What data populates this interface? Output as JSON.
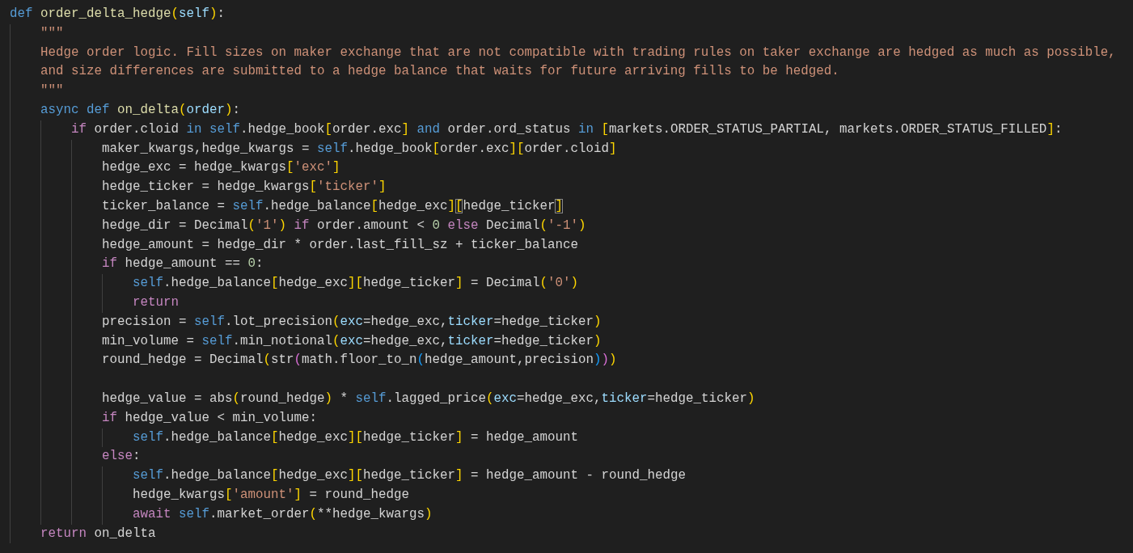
{
  "editor": {
    "lines": [
      {
        "kind": "code",
        "tokens": [
          {
            "kind": "kw",
            "text": "def"
          },
          {
            "kind": "fn",
            "text": " order_delta_hedge"
          },
          {
            "kind": "b1",
            "text": "("
          },
          {
            "kind": "var",
            "text": "self"
          },
          {
            "kind": "b1",
            "text": ")"
          },
          {
            "kind": "txt",
            "text": ":"
          }
        ],
        "children": [
          {
            "kind": "code",
            "tokens": [
              {
                "kind": "str",
                "text": "\"\"\""
              }
            ]
          },
          {
            "kind": "code",
            "tokens": [
              {
                "kind": "str",
                "text": "Hedge order logic. Fill sizes on maker exchange that are not compatible with trading rules on taker exchange are hedged as much as possible,"
              }
            ]
          },
          {
            "kind": "code",
            "tokens": [
              {
                "kind": "str",
                "text": "and size differences are submitted to a hedge balance that waits for future arriving fills to be hedged."
              }
            ]
          },
          {
            "kind": "code",
            "tokens": [
              {
                "kind": "str",
                "text": "\"\"\""
              }
            ]
          },
          {
            "kind": "code",
            "tokens": [
              {
                "kind": "kw",
                "text": "async def"
              },
              {
                "kind": "fn",
                "text": " on_delta"
              },
              {
                "kind": "b1",
                "text": "("
              },
              {
                "kind": "var",
                "text": "order"
              },
              {
                "kind": "b1",
                "text": ")"
              },
              {
                "kind": "txt",
                "text": ":"
              }
            ],
            "children": [
              {
                "kind": "code",
                "tokens": [
                  {
                    "kind": "ctl",
                    "text": "if"
                  },
                  {
                    "kind": "txt",
                    "text": " order.cloid"
                  },
                  {
                    "kind": "kw",
                    "text": " in"
                  },
                  {
                    "kind": "kw",
                    "text": " self"
                  },
                  {
                    "kind": "txt",
                    "text": ".hedge_book"
                  },
                  {
                    "kind": "b1",
                    "text": "["
                  },
                  {
                    "kind": "txt",
                    "text": "order.exc"
                  },
                  {
                    "kind": "b1",
                    "text": "]"
                  },
                  {
                    "kind": "kw",
                    "text": " and"
                  },
                  {
                    "kind": "txt",
                    "text": " order.ord_status"
                  },
                  {
                    "kind": "kw",
                    "text": " in"
                  },
                  {
                    "kind": "b1",
                    "text": " ["
                  },
                  {
                    "kind": "txt",
                    "text": "markets.ORDER_STATUS_PARTIAL, markets.ORDER_STATUS_FILLED"
                  },
                  {
                    "kind": "b1",
                    "text": "]"
                  },
                  {
                    "kind": "txt",
                    "text": ":"
                  }
                ],
                "children": [
                  {
                    "kind": "code",
                    "tokens": [
                      {
                        "kind": "txt",
                        "text": "maker_kwargs,hedge_kwargs ="
                      },
                      {
                        "kind": "kw",
                        "text": " self"
                      },
                      {
                        "kind": "txt",
                        "text": ".hedge_book"
                      },
                      {
                        "kind": "b1",
                        "text": "["
                      },
                      {
                        "kind": "txt",
                        "text": "order.exc"
                      },
                      {
                        "kind": "b1",
                        "text": "]"
                      },
                      {
                        "kind": "b1",
                        "text": "["
                      },
                      {
                        "kind": "txt",
                        "text": "order.cloid"
                      },
                      {
                        "kind": "b1",
                        "text": "]"
                      }
                    ]
                  },
                  {
                    "kind": "code",
                    "tokens": [
                      {
                        "kind": "txt",
                        "text": "hedge_exc = hedge_kwargs"
                      },
                      {
                        "kind": "b1",
                        "text": "["
                      },
                      {
                        "kind": "str",
                        "text": "'exc'"
                      },
                      {
                        "kind": "b1",
                        "text": "]"
                      }
                    ]
                  },
                  {
                    "kind": "code",
                    "tokens": [
                      {
                        "kind": "txt",
                        "text": "hedge_ticker = hedge_kwargs"
                      },
                      {
                        "kind": "b1",
                        "text": "["
                      },
                      {
                        "kind": "str",
                        "text": "'ticker'"
                      },
                      {
                        "kind": "b1",
                        "text": "]"
                      }
                    ]
                  },
                  {
                    "kind": "code",
                    "tokens": [
                      {
                        "kind": "txt",
                        "text": "ticker_balance ="
                      },
                      {
                        "kind": "kw",
                        "text": " self"
                      },
                      {
                        "kind": "txt",
                        "text": ".hedge_balance"
                      },
                      {
                        "kind": "b1",
                        "text": "["
                      },
                      {
                        "kind": "txt",
                        "text": "hedge_exc"
                      },
                      {
                        "kind": "b1",
                        "text": "]"
                      },
                      {
                        "kind": "bm",
                        "text": "["
                      },
                      {
                        "kind": "txt",
                        "text": "hedge_ticker"
                      },
                      {
                        "kind": "bm",
                        "text": "]"
                      }
                    ]
                  },
                  {
                    "kind": "code",
                    "tokens": [
                      {
                        "kind": "txt",
                        "text": "hedge_dir = Decimal"
                      },
                      {
                        "kind": "b1",
                        "text": "("
                      },
                      {
                        "kind": "str",
                        "text": "'1'"
                      },
                      {
                        "kind": "b1",
                        "text": ")"
                      },
                      {
                        "kind": "ctl",
                        "text": " if"
                      },
                      {
                        "kind": "txt",
                        "text": " order.amount <"
                      },
                      {
                        "kind": "num",
                        "text": " 0"
                      },
                      {
                        "kind": "ctl",
                        "text": " else"
                      },
                      {
                        "kind": "txt",
                        "text": " Decimal"
                      },
                      {
                        "kind": "b1",
                        "text": "("
                      },
                      {
                        "kind": "str",
                        "text": "'-1'"
                      },
                      {
                        "kind": "b1",
                        "text": ")"
                      }
                    ]
                  },
                  {
                    "kind": "code",
                    "tokens": [
                      {
                        "kind": "txt",
                        "text": "hedge_amount = hedge_dir * order.last_fill_sz + ticker_balance"
                      }
                    ]
                  },
                  {
                    "kind": "code",
                    "tokens": [
                      {
                        "kind": "ctl",
                        "text": "if"
                      },
                      {
                        "kind": "txt",
                        "text": " hedge_amount =="
                      },
                      {
                        "kind": "num",
                        "text": " 0"
                      },
                      {
                        "kind": "txt",
                        "text": ":"
                      }
                    ],
                    "children": [
                      {
                        "kind": "code",
                        "tokens": [
                          {
                            "kind": "kw",
                            "text": "self"
                          },
                          {
                            "kind": "txt",
                            "text": ".hedge_balance"
                          },
                          {
                            "kind": "b1",
                            "text": "["
                          },
                          {
                            "kind": "txt",
                            "text": "hedge_exc"
                          },
                          {
                            "kind": "b1",
                            "text": "]"
                          },
                          {
                            "kind": "b1",
                            "text": "["
                          },
                          {
                            "kind": "txt",
                            "text": "hedge_ticker"
                          },
                          {
                            "kind": "b1",
                            "text": "]"
                          },
                          {
                            "kind": "txt",
                            "text": " = Decimal"
                          },
                          {
                            "kind": "b1",
                            "text": "("
                          },
                          {
                            "kind": "str",
                            "text": "'0'"
                          },
                          {
                            "kind": "b1",
                            "text": ")"
                          }
                        ]
                      },
                      {
                        "kind": "code",
                        "tokens": [
                          {
                            "kind": "ctl",
                            "text": "return"
                          }
                        ]
                      }
                    ]
                  },
                  {
                    "kind": "code",
                    "tokens": [
                      {
                        "kind": "txt",
                        "text": "precision ="
                      },
                      {
                        "kind": "kw",
                        "text": " self"
                      },
                      {
                        "kind": "txt",
                        "text": ".lot_precision"
                      },
                      {
                        "kind": "b1",
                        "text": "("
                      },
                      {
                        "kind": "var",
                        "text": "exc"
                      },
                      {
                        "kind": "txt",
                        "text": "=hedge_exc,"
                      },
                      {
                        "kind": "var",
                        "text": "ticker"
                      },
                      {
                        "kind": "txt",
                        "text": "=hedge_ticker"
                      },
                      {
                        "kind": "b1",
                        "text": ")"
                      }
                    ]
                  },
                  {
                    "kind": "code",
                    "tokens": [
                      {
                        "kind": "txt",
                        "text": "min_volume ="
                      },
                      {
                        "kind": "kw",
                        "text": " self"
                      },
                      {
                        "kind": "txt",
                        "text": ".min_notional"
                      },
                      {
                        "kind": "b1",
                        "text": "("
                      },
                      {
                        "kind": "var",
                        "text": "exc"
                      },
                      {
                        "kind": "txt",
                        "text": "=hedge_exc,"
                      },
                      {
                        "kind": "var",
                        "text": "ticker"
                      },
                      {
                        "kind": "txt",
                        "text": "=hedge_ticker"
                      },
                      {
                        "kind": "b1",
                        "text": ")"
                      }
                    ]
                  },
                  {
                    "kind": "code",
                    "tokens": [
                      {
                        "kind": "txt",
                        "text": "round_hedge = Decimal"
                      },
                      {
                        "kind": "b1",
                        "text": "("
                      },
                      {
                        "kind": "txt",
                        "text": "str"
                      },
                      {
                        "kind": "b2",
                        "text": "("
                      },
                      {
                        "kind": "txt",
                        "text": "math.floor_to_n"
                      },
                      {
                        "kind": "b3",
                        "text": "("
                      },
                      {
                        "kind": "txt",
                        "text": "hedge_amount,precision"
                      },
                      {
                        "kind": "b3",
                        "text": ")"
                      },
                      {
                        "kind": "b2",
                        "text": ")"
                      },
                      {
                        "kind": "b1",
                        "text": ")"
                      }
                    ]
                  },
                  {
                    "kind": "blank"
                  },
                  {
                    "kind": "code",
                    "tokens": [
                      {
                        "kind": "txt",
                        "text": "hedge_value = abs"
                      },
                      {
                        "kind": "b1",
                        "text": "("
                      },
                      {
                        "kind": "txt",
                        "text": "round_hedge"
                      },
                      {
                        "kind": "b1",
                        "text": ")"
                      },
                      {
                        "kind": "txt",
                        "text": " *"
                      },
                      {
                        "kind": "kw",
                        "text": " self"
                      },
                      {
                        "kind": "txt",
                        "text": ".lagged_price"
                      },
                      {
                        "kind": "b1",
                        "text": "("
                      },
                      {
                        "kind": "var",
                        "text": "exc"
                      },
                      {
                        "kind": "txt",
                        "text": "=hedge_exc,"
                      },
                      {
                        "kind": "var",
                        "text": "ticker"
                      },
                      {
                        "kind": "txt",
                        "text": "=hedge_ticker"
                      },
                      {
                        "kind": "b1",
                        "text": ")"
                      }
                    ]
                  },
                  {
                    "kind": "code",
                    "tokens": [
                      {
                        "kind": "ctl",
                        "text": "if"
                      },
                      {
                        "kind": "txt",
                        "text": " hedge_value < min_volume:"
                      }
                    ],
                    "children": [
                      {
                        "kind": "code",
                        "tokens": [
                          {
                            "kind": "kw",
                            "text": "self"
                          },
                          {
                            "kind": "txt",
                            "text": ".hedge_balance"
                          },
                          {
                            "kind": "b1",
                            "text": "["
                          },
                          {
                            "kind": "txt",
                            "text": "hedge_exc"
                          },
                          {
                            "kind": "b1",
                            "text": "]"
                          },
                          {
                            "kind": "b1",
                            "text": "["
                          },
                          {
                            "kind": "txt",
                            "text": "hedge_ticker"
                          },
                          {
                            "kind": "b1",
                            "text": "]"
                          },
                          {
                            "kind": "txt",
                            "text": " = hedge_amount"
                          }
                        ]
                      }
                    ]
                  },
                  {
                    "kind": "code",
                    "tokens": [
                      {
                        "kind": "ctl",
                        "text": "else"
                      },
                      {
                        "kind": "txt",
                        "text": ":"
                      }
                    ],
                    "children": [
                      {
                        "kind": "code",
                        "tokens": [
                          {
                            "kind": "kw",
                            "text": "self"
                          },
                          {
                            "kind": "txt",
                            "text": ".hedge_balance"
                          },
                          {
                            "kind": "b1",
                            "text": "["
                          },
                          {
                            "kind": "txt",
                            "text": "hedge_exc"
                          },
                          {
                            "kind": "b1",
                            "text": "]"
                          },
                          {
                            "kind": "b1",
                            "text": "["
                          },
                          {
                            "kind": "txt",
                            "text": "hedge_ticker"
                          },
                          {
                            "kind": "b1",
                            "text": "]"
                          },
                          {
                            "kind": "txt",
                            "text": " = hedge_amount - round_hedge"
                          }
                        ]
                      },
                      {
                        "kind": "code",
                        "tokens": [
                          {
                            "kind": "txt",
                            "text": "hedge_kwargs"
                          },
                          {
                            "kind": "b1",
                            "text": "["
                          },
                          {
                            "kind": "str",
                            "text": "'amount'"
                          },
                          {
                            "kind": "b1",
                            "text": "]"
                          },
                          {
                            "kind": "txt",
                            "text": " = round_hedge"
                          }
                        ]
                      },
                      {
                        "kind": "code",
                        "tokens": [
                          {
                            "kind": "ctl",
                            "text": "await"
                          },
                          {
                            "kind": "kw",
                            "text": " self"
                          },
                          {
                            "kind": "txt",
                            "text": ".market_order"
                          },
                          {
                            "kind": "b1",
                            "text": "("
                          },
                          {
                            "kind": "txt",
                            "text": "**hedge_kwargs"
                          },
                          {
                            "kind": "b1",
                            "text": ")"
                          }
                        ]
                      }
                    ]
                  }
                ]
              }
            ]
          },
          {
            "kind": "code",
            "tokens": [
              {
                "kind": "ctl",
                "text": "return"
              },
              {
                "kind": "txt",
                "text": " on_delta"
              }
            ]
          }
        ]
      }
    ]
  }
}
